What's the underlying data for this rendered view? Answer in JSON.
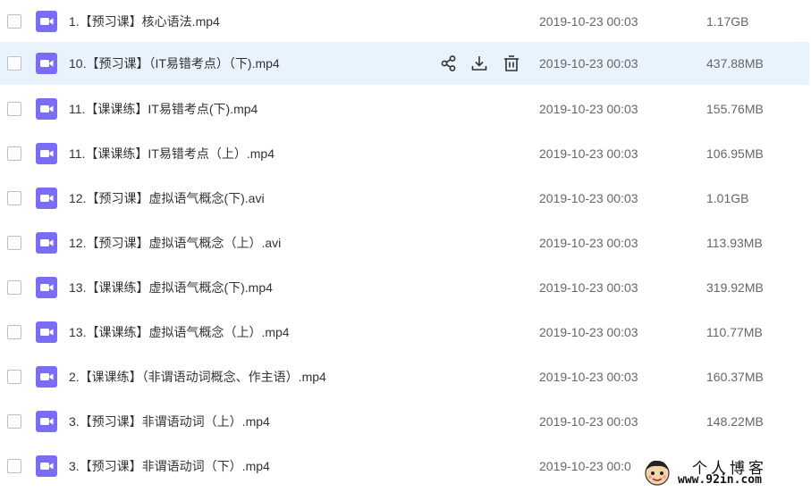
{
  "colors": {
    "hover_row": "#e9f3fd",
    "video_icon": "#7b6cf6",
    "text": "#333333",
    "meta": "#666666"
  },
  "files": [
    {
      "name": "1.【预习课】核心语法.mp4",
      "date": "2019-10-23 00:03",
      "size": "1.17GB",
      "icon": "video-file-icon"
    },
    {
      "name": "10.【预习课】（IT易错考点）（下).mp4",
      "date": "2019-10-23 00:03",
      "size": "437.88MB",
      "icon": "video-file-icon",
      "hovered": true
    },
    {
      "name": "11.【课课练】IT易错考点(下).mp4",
      "date": "2019-10-23 00:03",
      "size": "155.76MB",
      "icon": "video-file-icon"
    },
    {
      "name": "11.【课课练】IT易错考点（上）.mp4",
      "date": "2019-10-23 00:03",
      "size": "106.95MB",
      "icon": "video-file-icon"
    },
    {
      "name": "12.【预习课】虚拟语气概念(下).avi",
      "date": "2019-10-23 00:03",
      "size": "1.01GB",
      "icon": "video-file-icon"
    },
    {
      "name": "12.【预习课】虚拟语气概念（上）.avi",
      "date": "2019-10-23 00:03",
      "size": "113.93MB",
      "icon": "video-file-icon"
    },
    {
      "name": "13.【课课练】虚拟语气概念(下).mp4",
      "date": "2019-10-23 00:03",
      "size": "319.92MB",
      "icon": "video-file-icon"
    },
    {
      "name": "13.【课课练】虚拟语气概念（上）.mp4",
      "date": "2019-10-23 00:03",
      "size": "110.77MB",
      "icon": "video-file-icon"
    },
    {
      "name": "2.【课课练】（非谓语动词概念、作主语）.mp4",
      "date": "2019-10-23 00:03",
      "size": "160.37MB",
      "icon": "video-file-icon"
    },
    {
      "name": "3.【预习课】非谓语动词（上）.mp4",
      "date": "2019-10-23 00:03",
      "size": "148.22MB",
      "icon": "video-file-icon"
    },
    {
      "name": "3.【预习课】非谓语动词（下）.mp4",
      "date": "2019-10-23 00:0",
      "size": "",
      "icon": "video-file-icon"
    }
  ],
  "row_actions": [
    {
      "icon": "share-icon"
    },
    {
      "icon": "download-icon"
    },
    {
      "icon": "delete-icon"
    }
  ],
  "watermark": {
    "title": "个人博客",
    "url": "www.92in.com"
  }
}
